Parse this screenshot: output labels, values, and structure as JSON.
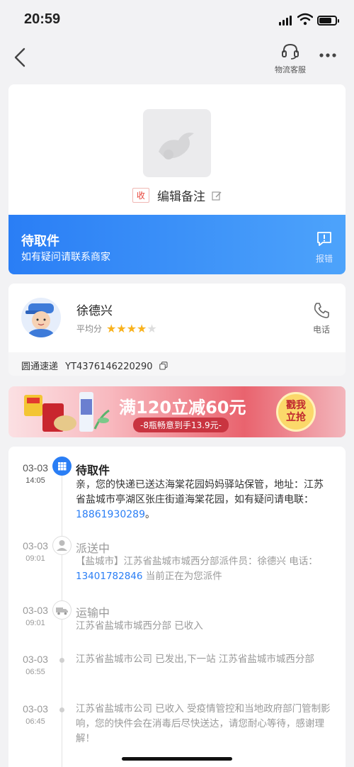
{
  "status_bar": {
    "time": "20:59"
  },
  "nav": {
    "service_label": "物流客服"
  },
  "package": {
    "tag": "收",
    "remark_label": "编辑备注",
    "status": "待取件",
    "status_sub": "如有疑问请联系商家",
    "report_label": "报错"
  },
  "courier": {
    "name": "徐德兴",
    "rating_label": "平均分",
    "stars_filled": 4,
    "stars_total": 5,
    "call_label": "电话",
    "carrier": "圆通速递",
    "tracking_no": "YT4376146220290"
  },
  "ad": {
    "headline": "满120立减60元",
    "sub": "-8瓶畅意到手13.9元-",
    "button_line1": "戳我",
    "button_line2": "立抢"
  },
  "timeline": [
    {
      "date": "03-03",
      "time": "14:05",
      "title": "待取件",
      "text_pre": "亲，您的快递已送达海棠花园妈妈驿站保管，地址：江苏省盐城市亭湖区张庄街道海棠花园，如有疑问请电联：",
      "phone": "18861930289",
      "text_post": "。"
    },
    {
      "date": "03-03",
      "time": "09:01",
      "title": "派送中",
      "text_pre": "【盐城市】江苏省盐城市城西分部派件员：徐德兴 电话：",
      "phone": "13401782846",
      "text_post": " 当前正在为您派件"
    },
    {
      "date": "03-03",
      "time": "09:01",
      "title": "运输中",
      "text_pre": "江苏省盐城市城西分部 已收入"
    },
    {
      "date": "03-03",
      "time": "06:55",
      "text_pre": "江苏省盐城市公司 已发出,下一站 江苏省盐城市城西分部"
    },
    {
      "date": "03-03",
      "time": "06:45",
      "text_pre": "江苏省盐城市公司 已收入 受疫情管控和当地政府部门管制影响，您的快件会在消毒后尽快送达，请您耐心等待，感谢理解！"
    }
  ],
  "colors": {
    "accent": "#2a7ef5",
    "star": "#f9b21d",
    "tag_red": "#e8443a"
  },
  "icons": [
    "back-arrow-icon",
    "headset-icon",
    "more-icon",
    "bird-placeholder-icon",
    "edit-icon",
    "report-icon",
    "phone-icon",
    "copy-icon",
    "grid-icon",
    "user-icon",
    "truck-icon"
  ]
}
